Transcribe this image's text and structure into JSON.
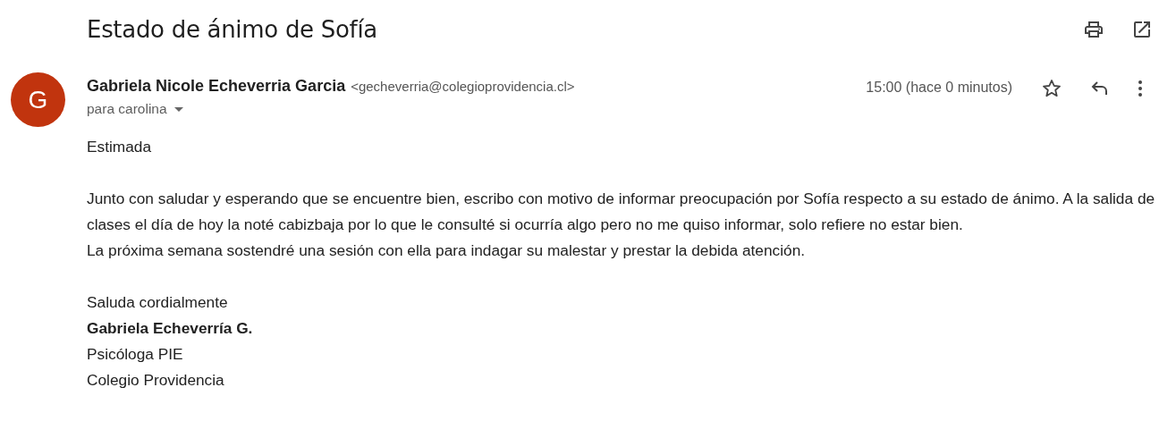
{
  "subject": "Estado de ánimo de Sofía",
  "sender": {
    "initial": "G",
    "name": "Gabriela Nicole Echeverria Garcia",
    "email": "<gecheverria@colegioprovidencia.cl>",
    "recipient": "para carolina",
    "time": "15:00 (hace 0 minutos)",
    "starred": false
  },
  "body": {
    "greeting": "Estimada",
    "paragraph": [
      "Junto con saludar y esperando que se encuentre bien, escribo con motivo de informar preocupación por Sofía respecto a su estado de ánimo. A la salida de clases el día de hoy la noté cabizbaja por lo que le consulté si ocurría algo pero no me quiso informar, solo refiere no estar bien.",
      "La próxima semana sostendré una sesión con ella para indagar su malestar y prestar la debida atención."
    ],
    "signature": {
      "closing": "Saluda cordialmente",
      "name": "Gabriela Echeverría G.",
      "role": "Psicóloga PIE",
      "school": "Colegio Providencia"
    }
  }
}
